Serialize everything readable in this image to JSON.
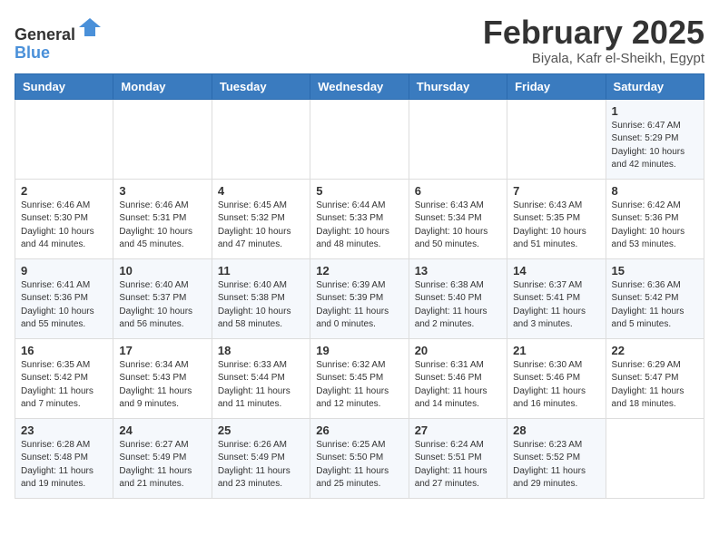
{
  "header": {
    "logo_line1": "General",
    "logo_line2": "Blue",
    "month_title": "February 2025",
    "location": "Biyala, Kafr el-Sheikh, Egypt"
  },
  "weekdays": [
    "Sunday",
    "Monday",
    "Tuesday",
    "Wednesday",
    "Thursday",
    "Friday",
    "Saturday"
  ],
  "weeks": [
    [
      {
        "day": "",
        "info": ""
      },
      {
        "day": "",
        "info": ""
      },
      {
        "day": "",
        "info": ""
      },
      {
        "day": "",
        "info": ""
      },
      {
        "day": "",
        "info": ""
      },
      {
        "day": "",
        "info": ""
      },
      {
        "day": "1",
        "info": "Sunrise: 6:47 AM\nSunset: 5:29 PM\nDaylight: 10 hours\nand 42 minutes."
      }
    ],
    [
      {
        "day": "2",
        "info": "Sunrise: 6:46 AM\nSunset: 5:30 PM\nDaylight: 10 hours\nand 44 minutes."
      },
      {
        "day": "3",
        "info": "Sunrise: 6:46 AM\nSunset: 5:31 PM\nDaylight: 10 hours\nand 45 minutes."
      },
      {
        "day": "4",
        "info": "Sunrise: 6:45 AM\nSunset: 5:32 PM\nDaylight: 10 hours\nand 47 minutes."
      },
      {
        "day": "5",
        "info": "Sunrise: 6:44 AM\nSunset: 5:33 PM\nDaylight: 10 hours\nand 48 minutes."
      },
      {
        "day": "6",
        "info": "Sunrise: 6:43 AM\nSunset: 5:34 PM\nDaylight: 10 hours\nand 50 minutes."
      },
      {
        "day": "7",
        "info": "Sunrise: 6:43 AM\nSunset: 5:35 PM\nDaylight: 10 hours\nand 51 minutes."
      },
      {
        "day": "8",
        "info": "Sunrise: 6:42 AM\nSunset: 5:36 PM\nDaylight: 10 hours\nand 53 minutes."
      }
    ],
    [
      {
        "day": "9",
        "info": "Sunrise: 6:41 AM\nSunset: 5:36 PM\nDaylight: 10 hours\nand 55 minutes."
      },
      {
        "day": "10",
        "info": "Sunrise: 6:40 AM\nSunset: 5:37 PM\nDaylight: 10 hours\nand 56 minutes."
      },
      {
        "day": "11",
        "info": "Sunrise: 6:40 AM\nSunset: 5:38 PM\nDaylight: 10 hours\nand 58 minutes."
      },
      {
        "day": "12",
        "info": "Sunrise: 6:39 AM\nSunset: 5:39 PM\nDaylight: 11 hours\nand 0 minutes."
      },
      {
        "day": "13",
        "info": "Sunrise: 6:38 AM\nSunset: 5:40 PM\nDaylight: 11 hours\nand 2 minutes."
      },
      {
        "day": "14",
        "info": "Sunrise: 6:37 AM\nSunset: 5:41 PM\nDaylight: 11 hours\nand 3 minutes."
      },
      {
        "day": "15",
        "info": "Sunrise: 6:36 AM\nSunset: 5:42 PM\nDaylight: 11 hours\nand 5 minutes."
      }
    ],
    [
      {
        "day": "16",
        "info": "Sunrise: 6:35 AM\nSunset: 5:42 PM\nDaylight: 11 hours\nand 7 minutes."
      },
      {
        "day": "17",
        "info": "Sunrise: 6:34 AM\nSunset: 5:43 PM\nDaylight: 11 hours\nand 9 minutes."
      },
      {
        "day": "18",
        "info": "Sunrise: 6:33 AM\nSunset: 5:44 PM\nDaylight: 11 hours\nand 11 minutes."
      },
      {
        "day": "19",
        "info": "Sunrise: 6:32 AM\nSunset: 5:45 PM\nDaylight: 11 hours\nand 12 minutes."
      },
      {
        "day": "20",
        "info": "Sunrise: 6:31 AM\nSunset: 5:46 PM\nDaylight: 11 hours\nand 14 minutes."
      },
      {
        "day": "21",
        "info": "Sunrise: 6:30 AM\nSunset: 5:46 PM\nDaylight: 11 hours\nand 16 minutes."
      },
      {
        "day": "22",
        "info": "Sunrise: 6:29 AM\nSunset: 5:47 PM\nDaylight: 11 hours\nand 18 minutes."
      }
    ],
    [
      {
        "day": "23",
        "info": "Sunrise: 6:28 AM\nSunset: 5:48 PM\nDaylight: 11 hours\nand 19 minutes."
      },
      {
        "day": "24",
        "info": "Sunrise: 6:27 AM\nSunset: 5:49 PM\nDaylight: 11 hours\nand 21 minutes."
      },
      {
        "day": "25",
        "info": "Sunrise: 6:26 AM\nSunset: 5:49 PM\nDaylight: 11 hours\nand 23 minutes."
      },
      {
        "day": "26",
        "info": "Sunrise: 6:25 AM\nSunset: 5:50 PM\nDaylight: 11 hours\nand 25 minutes."
      },
      {
        "day": "27",
        "info": "Sunrise: 6:24 AM\nSunset: 5:51 PM\nDaylight: 11 hours\nand 27 minutes."
      },
      {
        "day": "28",
        "info": "Sunrise: 6:23 AM\nSunset: 5:52 PM\nDaylight: 11 hours\nand 29 minutes."
      },
      {
        "day": "",
        "info": ""
      }
    ]
  ]
}
